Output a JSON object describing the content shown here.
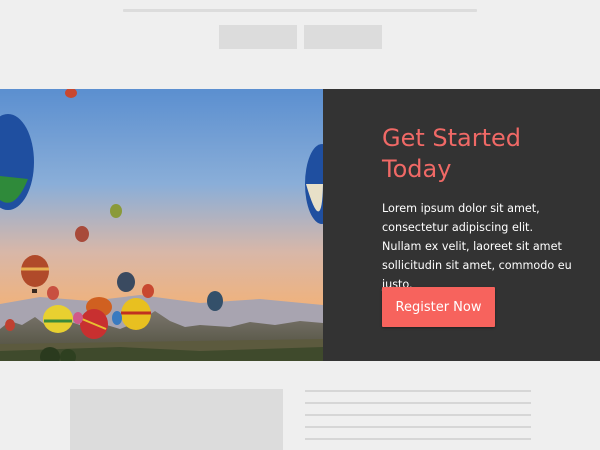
{
  "hero": {
    "title": "Get Started Today",
    "body": "Lorem ipsum dolor sit amet, consectetur adipiscing elit. Nullam ex velit, laoreet sit amet sollicitudin sit amet, commodo eu justo.",
    "cta_label": "Register Now",
    "image_subject": "hot air balloons over valley at sunrise"
  },
  "colors": {
    "accent": "#f06966",
    "button": "#f7635d",
    "panel": "#333333",
    "background": "#efefef",
    "placeholder": "#dcdcdc"
  }
}
